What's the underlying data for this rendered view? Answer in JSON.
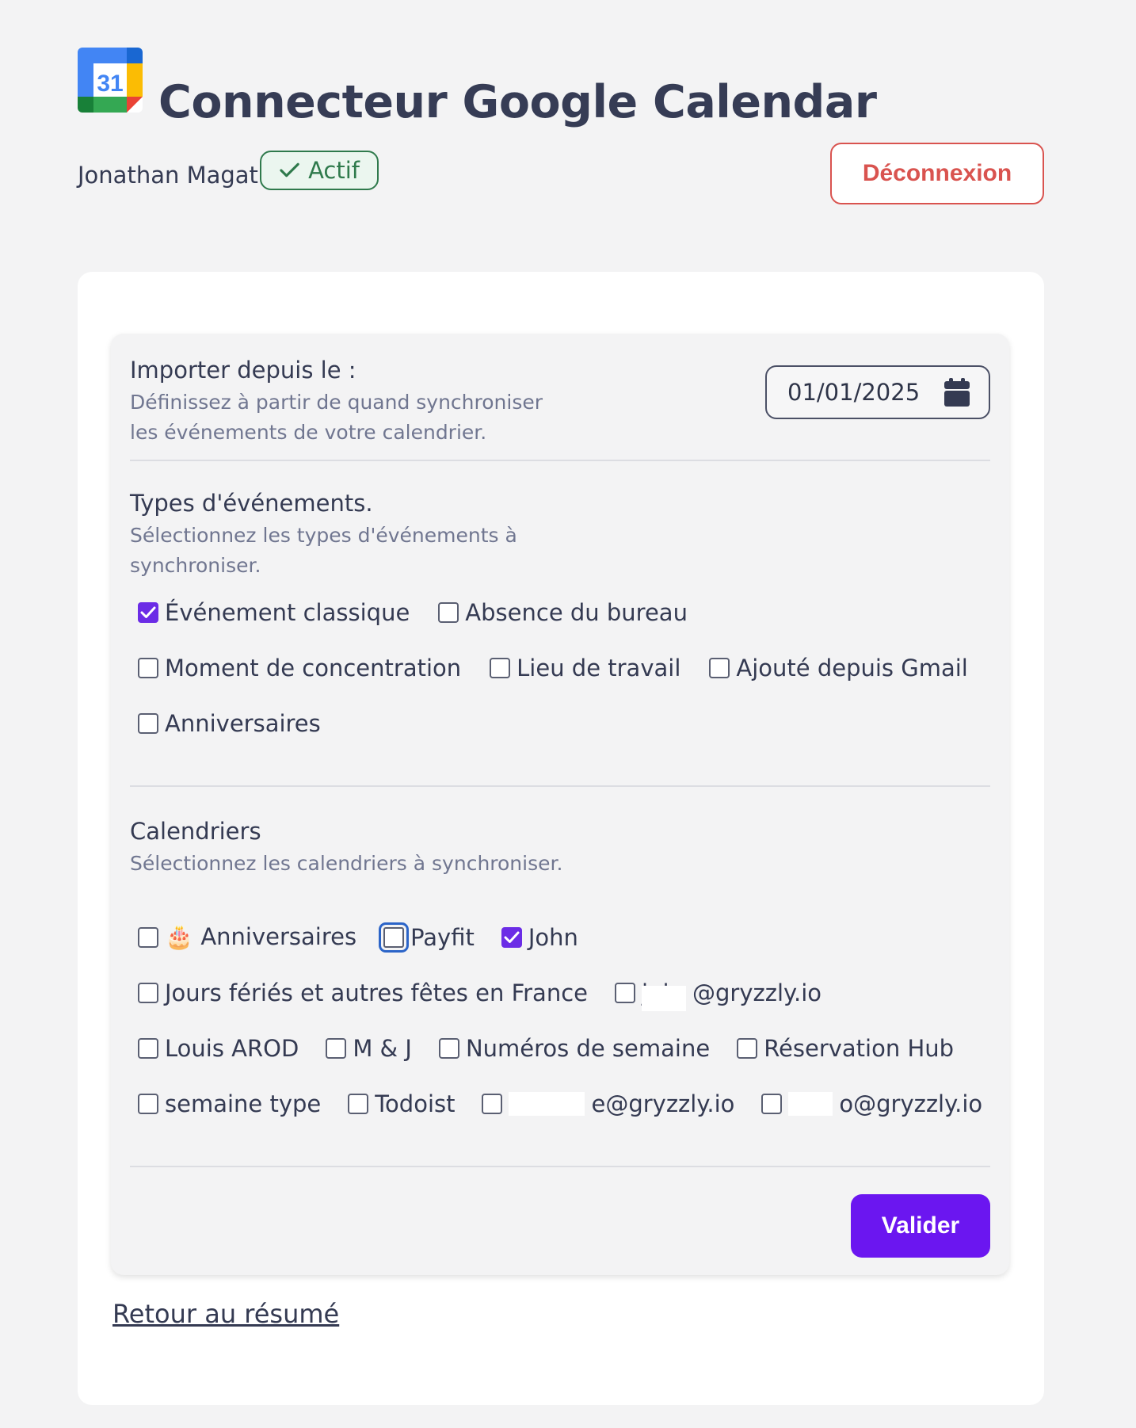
{
  "header": {
    "title": "Connecteur Google Calendar",
    "logo_icon": "google-calendar-icon",
    "logo_text": "31"
  },
  "user": {
    "name": "Jonathan Magat",
    "status": "Actif",
    "status_icon": "check-icon",
    "logout_label": "Déconnexion"
  },
  "import_section": {
    "title": "Importer depuis le :",
    "description_line1": "Définissez à partir de quand synchroniser",
    "description_line2": "les événements de votre calendrier.",
    "date_value": "01/01/2025",
    "date_icon": "calendar-icon"
  },
  "event_types": {
    "title": "Types d'événements.",
    "description_line1": "Sélectionnez les types d'événements à",
    "description_line2": "synchroniser.",
    "items": [
      {
        "label": "Événement classique",
        "checked": true
      },
      {
        "label": "Absence du bureau",
        "checked": false
      },
      {
        "label": "Moment de concentration",
        "checked": false
      },
      {
        "label": "Lieu de travail",
        "checked": false
      },
      {
        "label": "Ajouté depuis Gmail",
        "checked": false
      },
      {
        "label": "Anniversaires",
        "checked": false
      }
    ]
  },
  "calendars": {
    "title": "Calendriers",
    "description": "Sélectionnez les calendriers à synchroniser.",
    "items": [
      {
        "label": "🎂 Anniversaires",
        "checked": false
      },
      {
        "label": "Payfit",
        "checked": false,
        "focused": true
      },
      {
        "label": "John",
        "checked": true
      },
      {
        "label": "Jours fériés et autres fêtes en France",
        "checked": false
      },
      {
        "label": "@gryzzly.io",
        "checked": false,
        "redacted_prefix": "j..i"
      },
      {
        "label": "Louis AROD",
        "checked": false
      },
      {
        "label": "M & J",
        "checked": false
      },
      {
        "label": "Numéros de semaine",
        "checked": false
      },
      {
        "label": "Réservation Hub",
        "checked": false
      },
      {
        "label": "semaine type",
        "checked": false
      },
      {
        "label": "Todoist",
        "checked": false
      },
      {
        "label": "e@gryzzly.io",
        "checked": false
      },
      {
        "label": "o@gryzzly.io",
        "checked": false
      }
    ]
  },
  "actions": {
    "submit_label": "Valider",
    "back_label": "Retour au résumé"
  },
  "colors": {
    "accent": "#6b16f0",
    "danger": "#d9534f",
    "success": "#2f7a4c"
  }
}
